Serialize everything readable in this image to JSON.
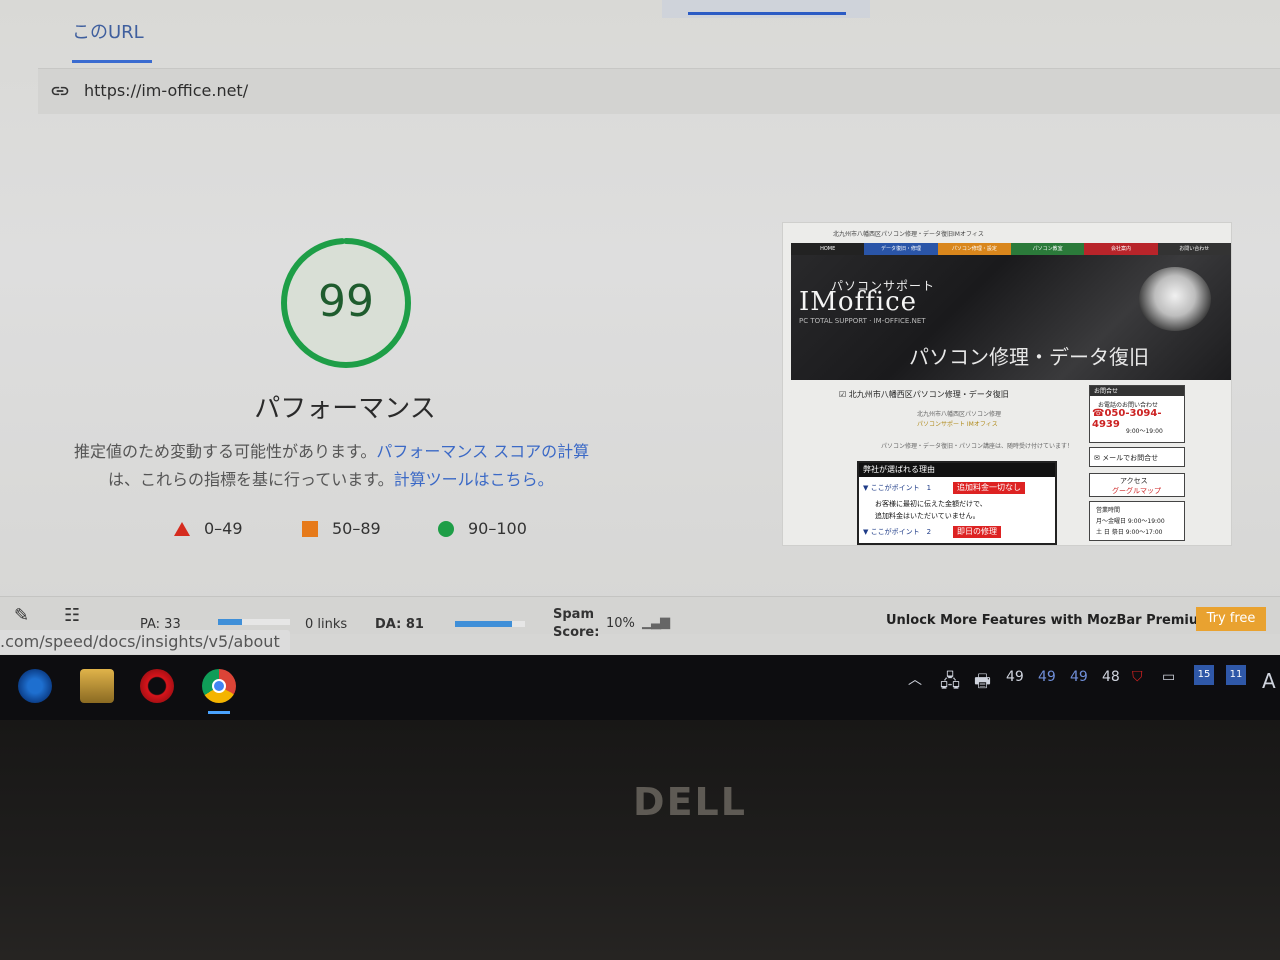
{
  "tabs": {
    "url_tab": "このURL"
  },
  "url_bar": {
    "url": "https://im-office.net/"
  },
  "score": {
    "value": "99",
    "fraction": 0.99,
    "title": "パフォーマンス",
    "desc_line1_text": "推定値のため変動する可能性があります。",
    "desc_line1_link": "パフォーマンス スコアの計算",
    "desc_line2_text": "は、これらの指標を基に行っています。",
    "desc_line2_link": "計算ツールはこちら。",
    "legend": [
      {
        "label": "0–49",
        "shape": "triangle",
        "color": "#d52b1e"
      },
      {
        "label": "50–89",
        "shape": "square",
        "color": "#e67a1a"
      },
      {
        "label": "90–100",
        "shape": "circle",
        "color": "#1e9e47"
      }
    ],
    "accent": "#1e9e47"
  },
  "preview": {
    "top_text": "北九州市八幡西区パソコン修理・データ復旧IMオフィス",
    "nav": [
      "HOME",
      "データ復旧・修理",
      "パソコン修理・設定",
      "パソコン教室",
      "会社案内",
      "お問い合わせ"
    ],
    "hero_sub": "パソコンサポート",
    "hero_brand": "IMoffice",
    "hero_tag": "PC TOTAL SUPPORT · IM-OFFICE.NET",
    "hero_headline": "パソコン修理・データ復旧",
    "check_text": "北九州市八幡西区パソコン修理・データ復旧",
    "small1": "北九州市八幡西区パソコン修理",
    "small2": "パソコンサポート IMオフィス",
    "small3": "パソコン修理・データ復旧・パソコン講座は、随時受け付けています！",
    "reason_head": "弊社が選ばれる理由",
    "point1": "▼ ここがポイント　1",
    "point1_red": "追加料金一切なし",
    "point1_body1": "お客様に最初に伝えた金額だけで、",
    "point1_body2": "追加料金はいただいていません。",
    "point2": "▼ ここがポイント　2",
    "point2_red": "即日の修理",
    "side_head": "お問合せ",
    "side_label": "お電話のお問い合わせ",
    "phone": "☎050-3094-4939",
    "hours": "9:00～19:00",
    "mail": "メールでお問合せ",
    "access1": "アクセス",
    "access2": "グーグルマップ",
    "biz1": "営業時間",
    "biz2": "月～金曜日 9:00～19:00",
    "biz3": "土 日 祭日 9:00～17:00"
  },
  "mozbar": {
    "pa": "PA: 33",
    "links": "0 links",
    "da": "DA: 81",
    "da_fraction": 0.81,
    "pa_fraction": 0.33,
    "spam_label_1": "Spam",
    "spam_label_2": "Score:",
    "spam_value": "10%",
    "premium": "Unlock More Features with MozBar Premium",
    "try": "Try free"
  },
  "status": {
    "url": ".com/speed/docs/insights/v5/about"
  },
  "taskbar": {
    "tray": [
      "49",
      "49",
      "49",
      "48"
    ],
    "box1": "15",
    "box2": "11",
    "edge_char": "A"
  },
  "bezel": {
    "brand": "DELL"
  }
}
